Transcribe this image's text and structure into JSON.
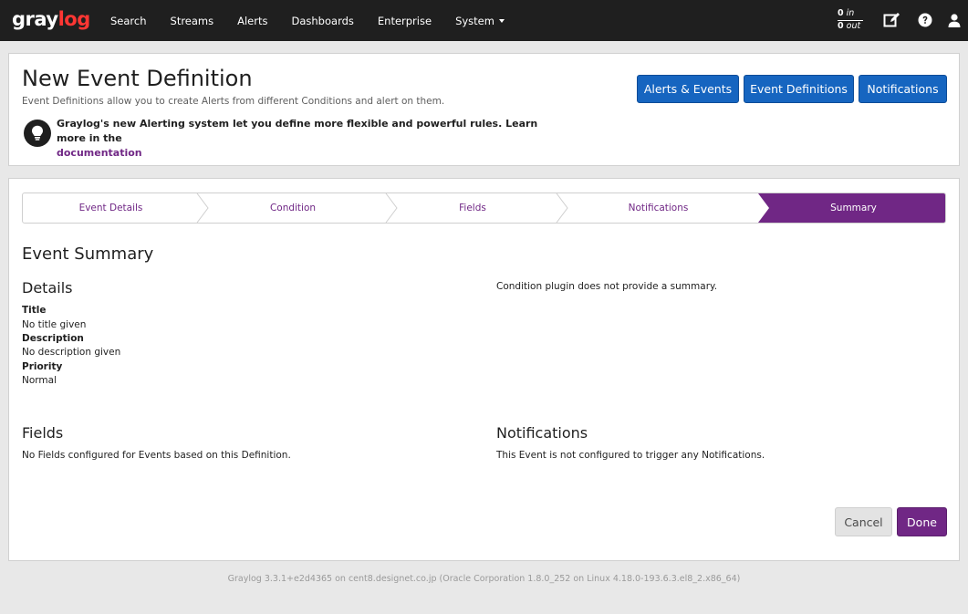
{
  "navbar": {
    "brand_part1": "gray",
    "brand_part2": "log",
    "links": {
      "search": "Search",
      "streams": "Streams",
      "alerts": "Alerts",
      "dashboards": "Dashboards",
      "enterprise": "Enterprise",
      "system": "System"
    },
    "throughput": {
      "in_count": "0",
      "in_label": "in",
      "out_count": "0",
      "out_label": "out"
    },
    "icons": [
      "edit-icon",
      "help-icon",
      "user-icon"
    ]
  },
  "header": {
    "title": "New Event Definition",
    "subtitle": "Event Definitions allow you to create Alerts from different Conditions and alert on them.",
    "tip_text": "Graylog's new Alerting system let you define more flexible and powerful rules. Learn more in the",
    "tip_link": "documentation",
    "buttons": {
      "alerts_events": "Alerts & Events",
      "event_definitions": "Event Definitions",
      "notifications": "Notifications"
    }
  },
  "wizard": {
    "steps": [
      {
        "label": "Event Details",
        "active": false
      },
      {
        "label": "Condition",
        "active": false
      },
      {
        "label": "Fields",
        "active": false
      },
      {
        "label": "Notifications",
        "active": false
      },
      {
        "label": "Summary",
        "active": true
      }
    ],
    "active_color": "#702785"
  },
  "summary": {
    "heading": "Event Summary",
    "details": {
      "heading": "Details",
      "title_label": "Title",
      "title_value": "No title given",
      "description_label": "Description",
      "description_value": "No description given",
      "priority_label": "Priority",
      "priority_value": "Normal"
    },
    "condition_text": "Condition plugin does not provide a summary.",
    "fields": {
      "heading": "Fields",
      "text": "No Fields configured for Events based on this Definition."
    },
    "notifications": {
      "heading": "Notifications",
      "text": "This Event is not configured to trigger any Notifications."
    }
  },
  "actions": {
    "cancel": "Cancel",
    "done": "Done"
  },
  "footer": "Graylog 3.3.1+e2d4365 on cent8.designet.co.jp (Oracle Corporation 1.8.0_252 on Linux 4.18.0-193.6.3.el8_2.x86_64)",
  "colors": {
    "navbar": "#1f1f1f",
    "primary_blue": "#1665c0",
    "accent_purple": "#702785",
    "brand_red": "#ff3633"
  }
}
